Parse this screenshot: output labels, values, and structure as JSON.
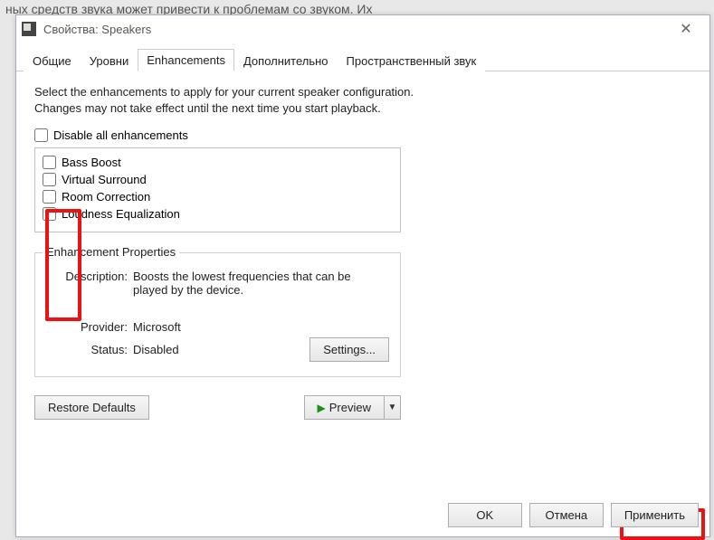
{
  "background_text": "ных средств звука может привести к проблемам со звуком. Их",
  "window": {
    "title": "Свойства: Speakers",
    "tabs": [
      "Общие",
      "Уровни",
      "Enhancements",
      "Дополнительно",
      "Пространственный звук"
    ],
    "active_tab_index": 2
  },
  "intro": "Select the enhancements to apply for your current speaker configuration. Changes may not take effect until the next time you start playback.",
  "disable_all_label": "Disable all enhancements",
  "enhancements": [
    {
      "label": "Bass Boost",
      "checked": false
    },
    {
      "label": "Virtual Surround",
      "checked": false
    },
    {
      "label": "Room Correction",
      "checked": false
    },
    {
      "label": "Loudness Equalization",
      "checked": false
    }
  ],
  "properties": {
    "legend": "Enhancement Properties",
    "description_label": "Description:",
    "description_value": "Boosts the lowest frequencies that can be played by the device.",
    "provider_label": "Provider:",
    "provider_value": "Microsoft",
    "status_label": "Status:",
    "status_value": "Disabled",
    "settings_button": "Settings..."
  },
  "restore_defaults": "Restore Defaults",
  "preview": "Preview",
  "buttons": {
    "ok": "OK",
    "cancel": "Отмена",
    "apply": "Применить"
  }
}
